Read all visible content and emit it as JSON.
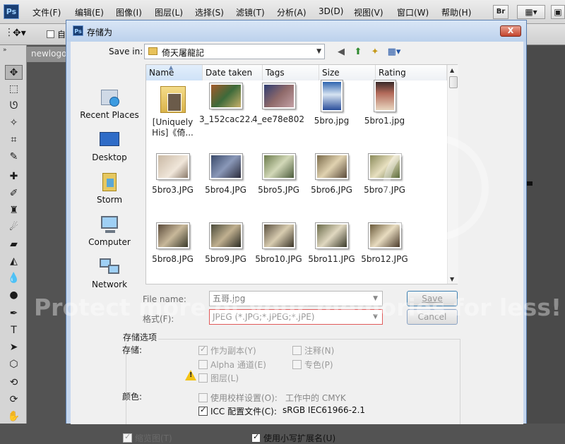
{
  "app": {
    "logo": "Ps",
    "menu": [
      "文件(F)",
      "编辑(E)",
      "图像(I)",
      "图层(L)",
      "选择(S)",
      "滤镜(T)",
      "分析(A)",
      "3D(D)",
      "视图(V)",
      "窗口(W)",
      "帮助(H)"
    ],
    "bridge_button": "Br",
    "document_tab": "newlogo",
    "options_checkbox_label": "自"
  },
  "dialog": {
    "title": "存储为",
    "close_label": "X",
    "save_in_label": "Save in:",
    "save_in_value": "倚天屠龍記",
    "places": [
      "Recent Places",
      "Desktop",
      "Storm",
      "Computer",
      "Network"
    ],
    "columns": [
      "Name",
      "Date taken",
      "Tags",
      "Size",
      "Rating"
    ],
    "files": [
      {
        "name": "[Uniquely His]《倚...",
        "kind": "folder"
      },
      {
        "name": "3_152cac22...",
        "kind": "image"
      },
      {
        "name": "4_ee78e802...",
        "kind": "image"
      },
      {
        "name": "5bro.jpg",
        "kind": "image"
      },
      {
        "name": "5bro1.jpg",
        "kind": "image"
      },
      {
        "name": "5bro3.JPG",
        "kind": "image"
      },
      {
        "name": "5bro4.JPG",
        "kind": "image"
      },
      {
        "name": "5bro5.JPG",
        "kind": "image"
      },
      {
        "name": "5bro6.JPG",
        "kind": "image"
      },
      {
        "name": "5bro7.JPG",
        "kind": "image"
      },
      {
        "name": "5bro8.JPG",
        "kind": "image"
      },
      {
        "name": "5bro9.JPG",
        "kind": "image"
      },
      {
        "name": "5bro10.JPG",
        "kind": "image"
      },
      {
        "name": "5bro11.JPG",
        "kind": "image"
      },
      {
        "name": "5bro12.JPG",
        "kind": "image"
      }
    ],
    "file_name_label": "File name:",
    "file_name_value": "五哥.jpg",
    "format_label": "格式(F):",
    "format_value": "JPEG (*.JPG;*.JPEG;*.JPE)",
    "save_button": "Save",
    "cancel_button": "Cancel",
    "save_options_title": "存储选项",
    "save_label": "存储:",
    "options": {
      "as_copy": "作为副本(Y)",
      "notes": "注释(N)",
      "alpha": "Alpha 通道(E)",
      "spot": "专色(P)",
      "layers": "图层(L)"
    },
    "color_label": "颜色:",
    "use_proof": "使用校样设置(O):",
    "proof_value": "工作中的 CMYK",
    "icc_label": "ICC 配置文件(C):",
    "icc_value": "sRGB IEC61966-2.1",
    "thumbnail": "缩览图(T)",
    "lowercase_ext": "使用小写扩展名(U)"
  },
  "watermark_text": "Protect more of your memories for less!",
  "colors": {
    "dialog_frame": "#c4d6ee",
    "error_border": "#e05a5a",
    "ps_blue": "#1b3f73"
  }
}
